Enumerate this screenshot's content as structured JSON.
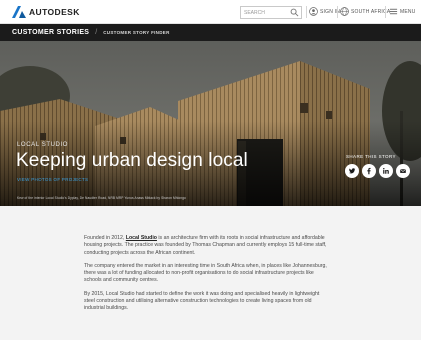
{
  "header": {
    "brand": "AUTODESK",
    "search_placeholder": "SEARCH",
    "sign_in_label": "SIGN IN",
    "region_label": "SOUTH AFRICA",
    "menu_label": "MENU"
  },
  "subnav": {
    "section": "CUSTOMER STORIES",
    "separator": "/",
    "page": "CUSTOMER STORY FINDER"
  },
  "hero": {
    "category": "LOCAL STUDIO",
    "title": "Keeping urban design local",
    "link": "VIEW PHOTOS OF PROJECTS",
    "caption": "Kew of the interior Local Studio's Dyplay, De Naudter Road, NRB MRP Yunus Anass Mblack by Sharon Mhlongo",
    "share_label": "SHARE THIS STORY",
    "share_icons": [
      "twitter-icon",
      "facebook-icon",
      "linkedin-icon",
      "email-icon"
    ]
  },
  "story": {
    "p1_before": "Founded in 2012, ",
    "p1_strong": "Local Studio",
    "p1_after": " is an architecture firm with its roots in social infrastructure and affordable housing projects. The practice was founded by Thomas Chapman and currently employs 15 full-time staff, conducting projects across the African continent.",
    "p2": "The company entered the market in an interesting time in South Africa when, in places like Johannesburg, there was a lot of funding allocated to non-profit organisations to do social infrastructure projects like schools and community centres.",
    "p3": "By 2015, Local Studio had started to define the work it was doing and specialised heavily in lightweight steel construction and utilising alternative construction technologies to create living spaces from old industrial buildings."
  },
  "colors": {
    "subnav_bg": "#1b1b1b",
    "link_blue": "#3aa0e0",
    "body_bg": "#f3f3f3"
  }
}
